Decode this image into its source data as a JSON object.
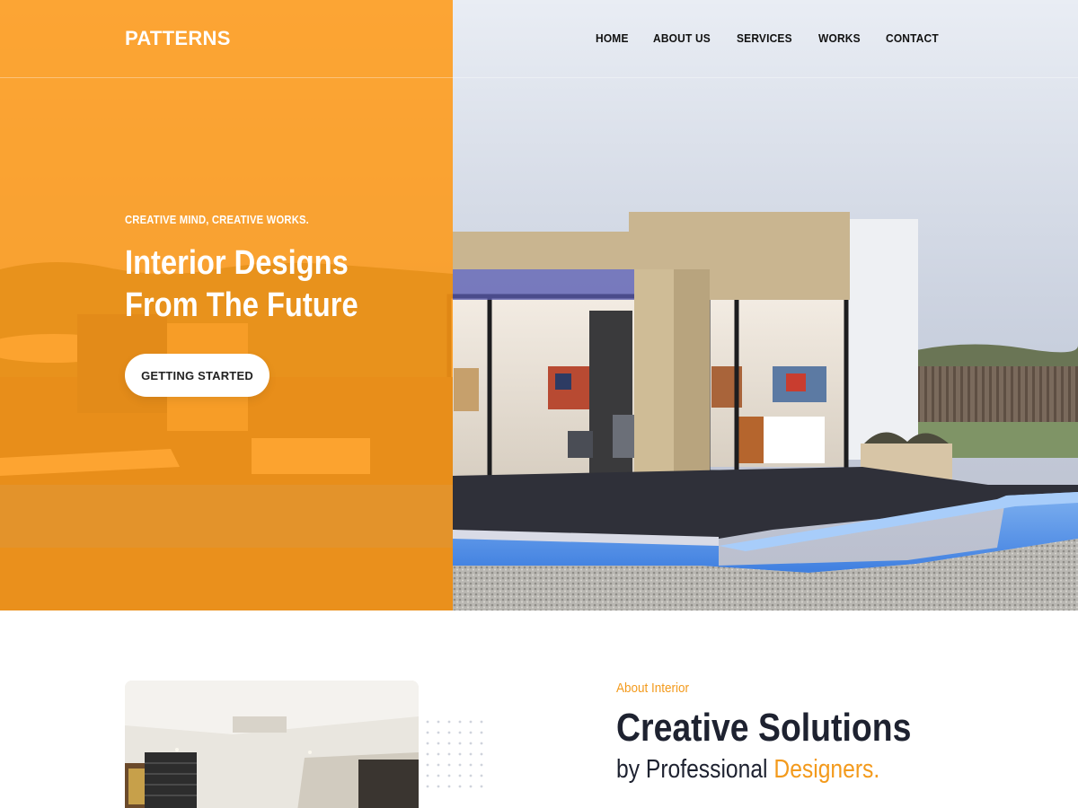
{
  "brand": {
    "logo_text": "PATTERNS"
  },
  "nav": {
    "items": [
      {
        "label": "HOME"
      },
      {
        "label": "ABOUT US"
      },
      {
        "label": "SERVICES"
      },
      {
        "label": "WORKS"
      },
      {
        "label": "CONTACT"
      }
    ]
  },
  "hero": {
    "kicker": "CREATIVE MIND, CREATIVE WORKS.",
    "title_line1": "Interior Designs",
    "title_line2": "From The Future",
    "cta_label": "GETTING STARTED",
    "overlay_color": "#ff9914"
  },
  "about": {
    "kicker": "About Interior",
    "title": "Creative Solutions",
    "subtitle_prefix": "by Professional",
    "subtitle_accent": "Designers.",
    "accent_color": "#f39a1c"
  }
}
